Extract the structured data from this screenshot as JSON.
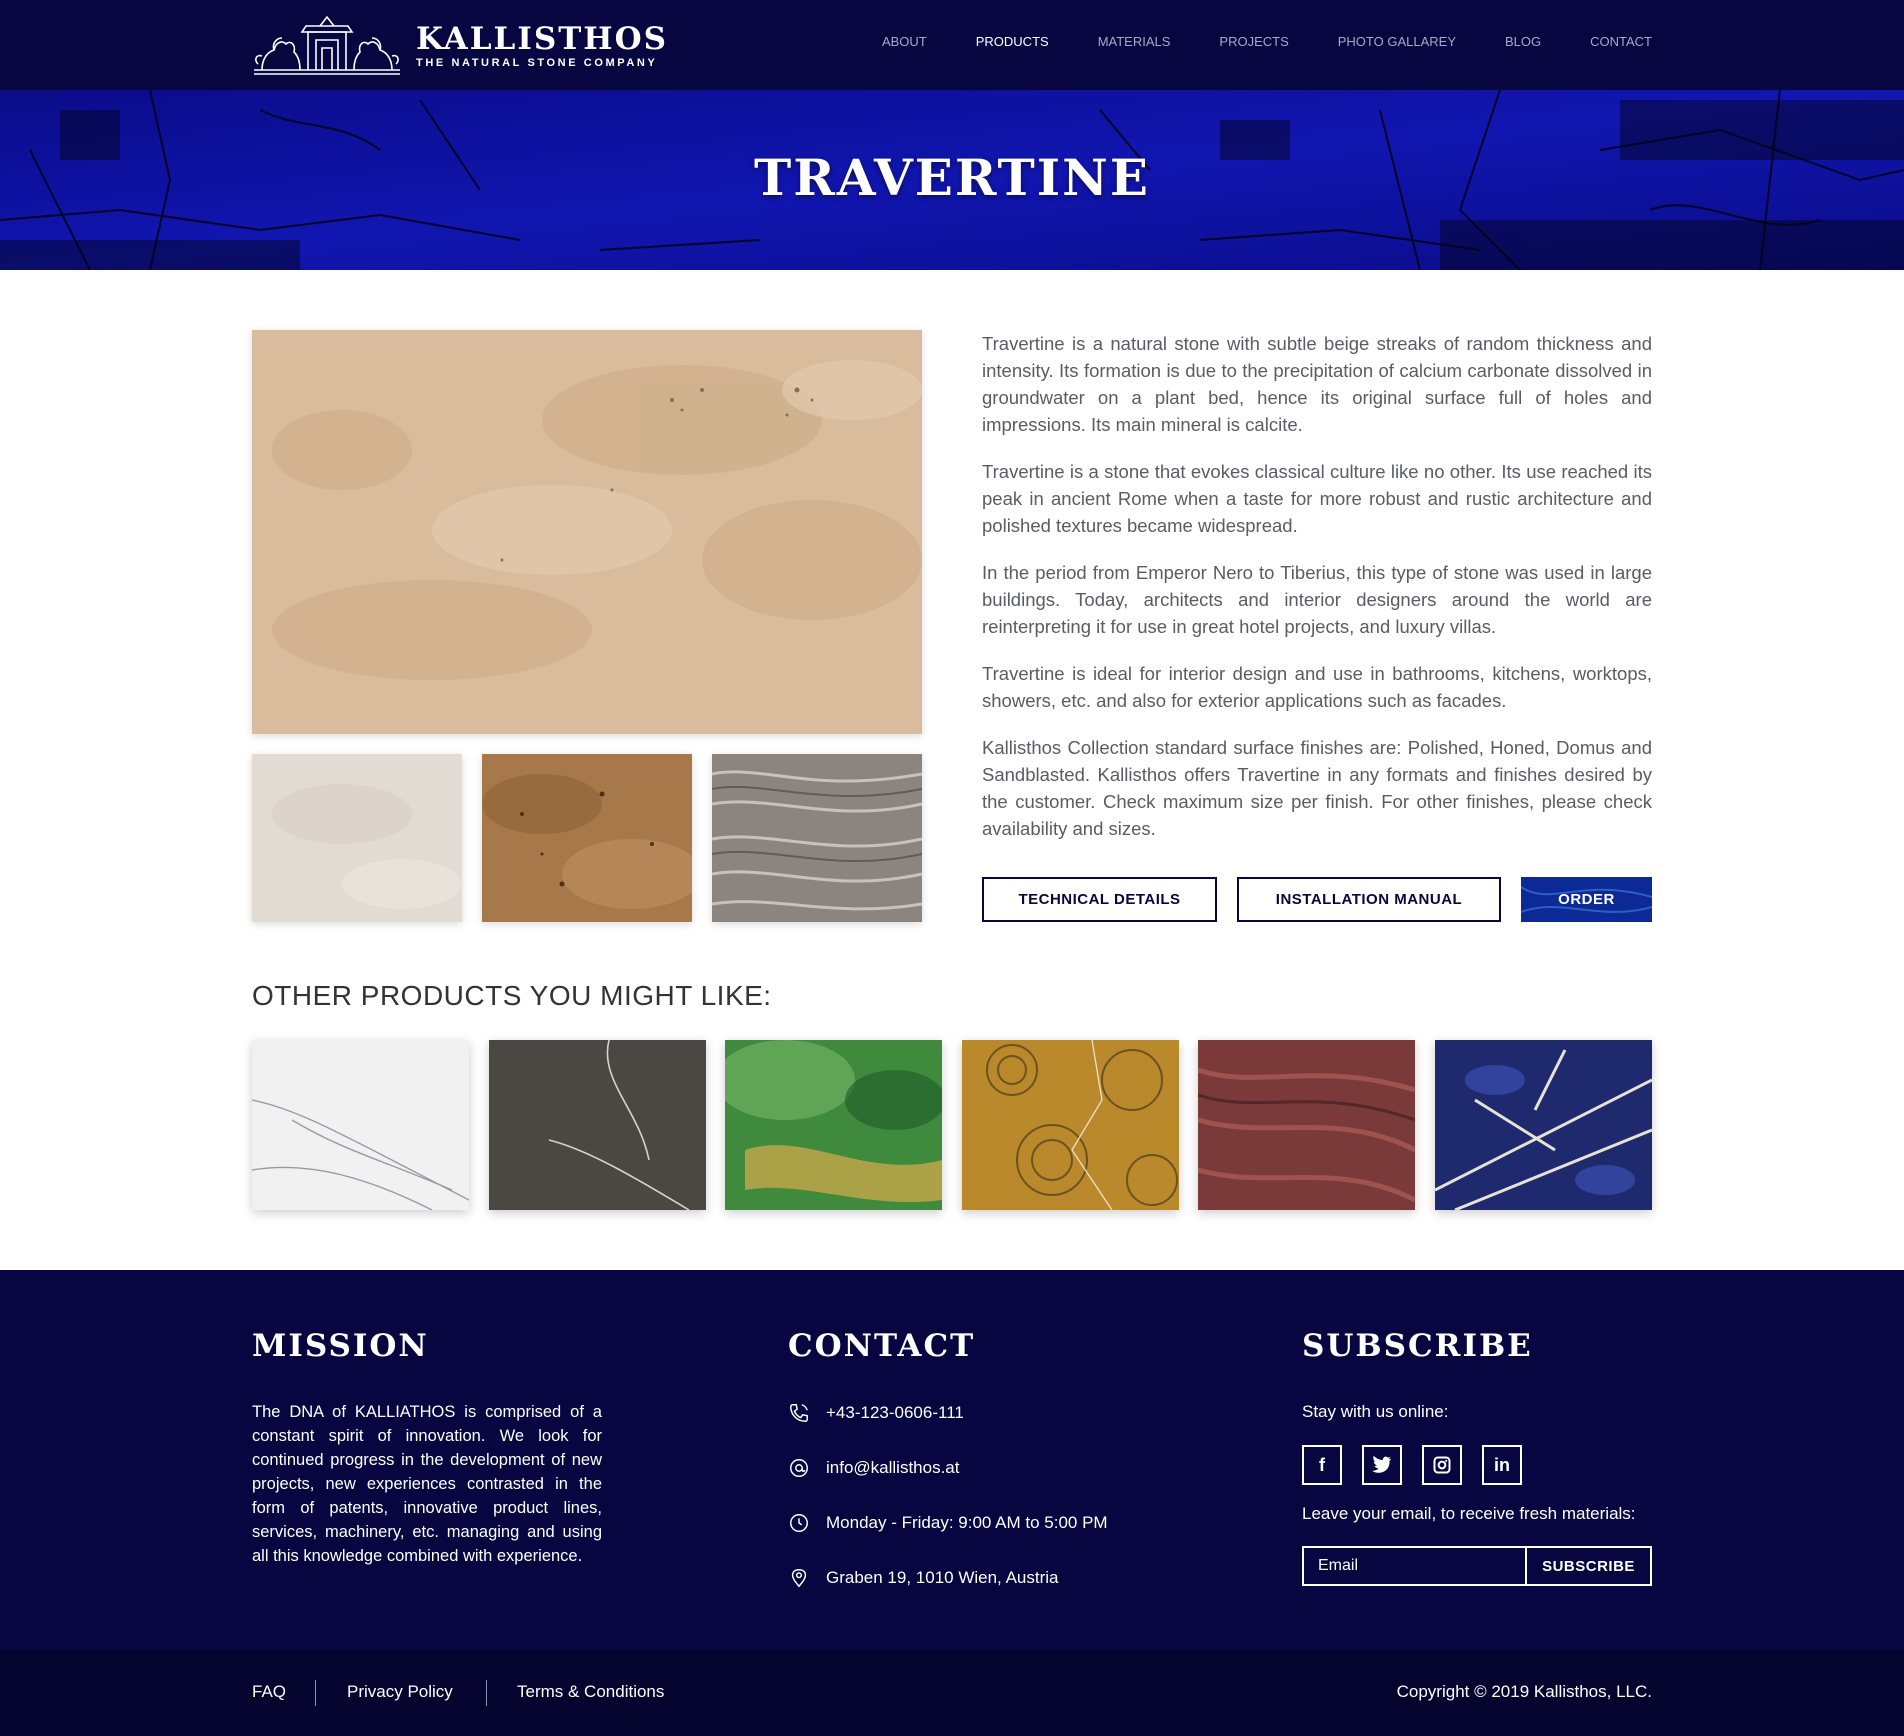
{
  "brand": {
    "name": "KALLISTHOS",
    "tagline": "THE NATURAL STONE COMPANY"
  },
  "nav": {
    "items": [
      {
        "label": "ABOUT",
        "active": false
      },
      {
        "label": "PRODUCTS",
        "active": true
      },
      {
        "label": "MATERIALS",
        "active": false
      },
      {
        "label": "PROJECTS",
        "active": false
      },
      {
        "label": "PHOTO GALLAREY",
        "active": false
      },
      {
        "label": "BLOG",
        "active": false
      },
      {
        "label": "CONTACT",
        "active": false
      }
    ]
  },
  "hero": {
    "title": "TRAVERTINE"
  },
  "product": {
    "paragraphs": [
      "Travertine is a natural stone with subtle beige streaks of random thickness and intensity. Its formation is due to the precipitation of calcium carbonate dissolved in groundwater on a plant bed, hence its original surface full of holes and impressions. Its main mineral is calcite.",
      "Travertine is a stone that evokes classical culture like no other. Its use reached its peak in ancient Rome when a taste for more robust and rustic architecture and polished textures became widespread.",
      "In the period from Emperor Nero to Tiberius, this type of stone was used in large buildings. Today, architects and interior designers around the world are reinterpreting it for use in great hotel projects, and luxury villas.",
      "Travertine is ideal for interior design and use in bathrooms, kitchens, worktops, showers, etc. and also for exterior applications such as facades.",
      "Kallisthos Collection standard surface finishes are: Polished, Honed, Domus and Sandblasted. Kallisthos offers Travertine in any formats and finishes desired by the customer. Check maximum size per finish. For other finishes, please check availability and sizes."
    ],
    "buttons": {
      "technical": "TECHNICAL DETAILS",
      "manual": "INSTALLATION MANUAL",
      "order": "ORDER"
    }
  },
  "other": {
    "title": "OTHER PRODUCTS YOU MIGHT LIKE:"
  },
  "footer": {
    "mission": {
      "heading": "MISSION",
      "text": "The DNA of KALLIATHOS is comprised of a constant spirit of innovation. We look for continued progress in the development of new projects, new experiences contrasted in the form of patents, innovative product lines, services, machinery, etc. managing and using all this knowledge combined with experience."
    },
    "contact": {
      "heading": "CONTACT",
      "phone": "+43-123-0606-111",
      "email": "info@kallisthos.at",
      "hours": "Monday - Friday: 9:00 AM to 5:00 PM",
      "address": "Graben 19, 1010 Wien, Austria"
    },
    "subscribe": {
      "heading": "SUBSCRIBE",
      "stay": "Stay with us online:",
      "leave": "Leave your email, to receive fresh materials:",
      "placeholder": "Email",
      "button": "SUBSCRIBE",
      "social": [
        "facebook-icon",
        "twitter-icon",
        "instagram-icon",
        "linkedin-icon"
      ]
    },
    "links": [
      "FAQ",
      "Privacy Policy",
      "Terms & Conditions"
    ],
    "copyright": "Copyright © 2019 Kallisthos, LLC."
  },
  "colors": {
    "navy": "#070640",
    "hero_blue": "#0d0fa0",
    "text_gray": "#5b5b66"
  }
}
